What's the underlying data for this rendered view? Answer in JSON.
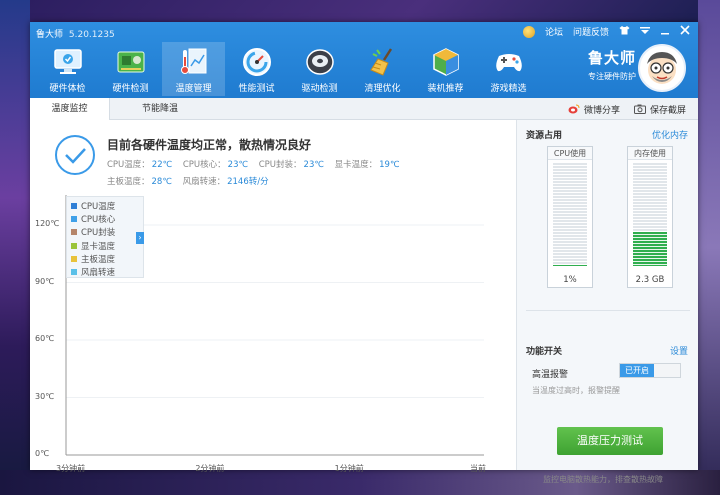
{
  "app": {
    "title": "鲁大师",
    "version": "5.20.1235"
  },
  "title_actions": {
    "forum": "论坛",
    "feedback": "问题反馈"
  },
  "toolbar": [
    {
      "label": "硬件体检",
      "icon": "monitor-check-icon"
    },
    {
      "label": "硬件检测",
      "icon": "circuit-board-icon"
    },
    {
      "label": "温度管理",
      "icon": "thermometer-icon"
    },
    {
      "label": "性能测试",
      "icon": "speedometer-icon"
    },
    {
      "label": "驱动检测",
      "icon": "driver-disk-icon"
    },
    {
      "label": "清理优化",
      "icon": "broom-icon"
    },
    {
      "label": "装机推荐",
      "icon": "cube-icon"
    },
    {
      "label": "游戏精选",
      "icon": "gamepad-icon"
    }
  ],
  "brand": {
    "name": "鲁大师",
    "slogan": "专注硬件防护"
  },
  "subtabs": [
    "温度监控",
    "节能降温"
  ],
  "sub_actions": {
    "share": "微博分享",
    "screenshot": "保存截屏"
  },
  "status": {
    "title": "目前各硬件温度均正常，散热情况良好",
    "cpu_temp_label": "CPU温度：",
    "cpu_temp": "22℃",
    "cpu_core_label": "CPU核心：",
    "cpu_core": "23℃",
    "cpu_pkg_label": "CPU封装：",
    "cpu_pkg": "23℃",
    "gpu_label": "显卡温度：",
    "gpu": "19℃",
    "board_label": "主板温度：",
    "board": "28℃",
    "fan_label": "风扇转速：",
    "fan": "2146转/分"
  },
  "chart_data": {
    "type": "line",
    "y_ticks": [
      "120℃",
      "90℃",
      "60℃",
      "30℃",
      "0℃"
    ],
    "x_ticks": [
      "3分钟前",
      "2分钟前",
      "1分钟前",
      "当前"
    ],
    "ylim": [
      0,
      120
    ],
    "grid": true,
    "legend_position": "top-left",
    "series": [
      {
        "name": "CPU温度",
        "color": "#2f7fd6",
        "values": []
      },
      {
        "name": "CPU核心",
        "color": "#3fa0e8",
        "values": []
      },
      {
        "name": "CPU封装",
        "color": "#b5856a",
        "values": []
      },
      {
        "name": "显卡温度",
        "color": "#9ac43a",
        "values": []
      },
      {
        "name": "主板温度",
        "color": "#e8c23a",
        "values": []
      },
      {
        "name": "风扇转速",
        "color": "#5ac0e8",
        "values": []
      }
    ]
  },
  "resources": {
    "title": "资源占用",
    "optimize": "优化内存",
    "cpu": {
      "label": "CPU使用",
      "value": "1%",
      "fraction": 0.01
    },
    "mem": {
      "label": "内存使用",
      "value": "2.3 GB",
      "fraction": 0.33
    }
  },
  "features": {
    "title": "功能开关",
    "settings": "设置",
    "alarm_label": "高温报警",
    "alarm_state": "已开启",
    "alarm_hint": "当温度过高时，报警提醒"
  },
  "stress": {
    "button": "温度压力测试",
    "hint": "监控电脑散热能力，排查散热故障"
  }
}
